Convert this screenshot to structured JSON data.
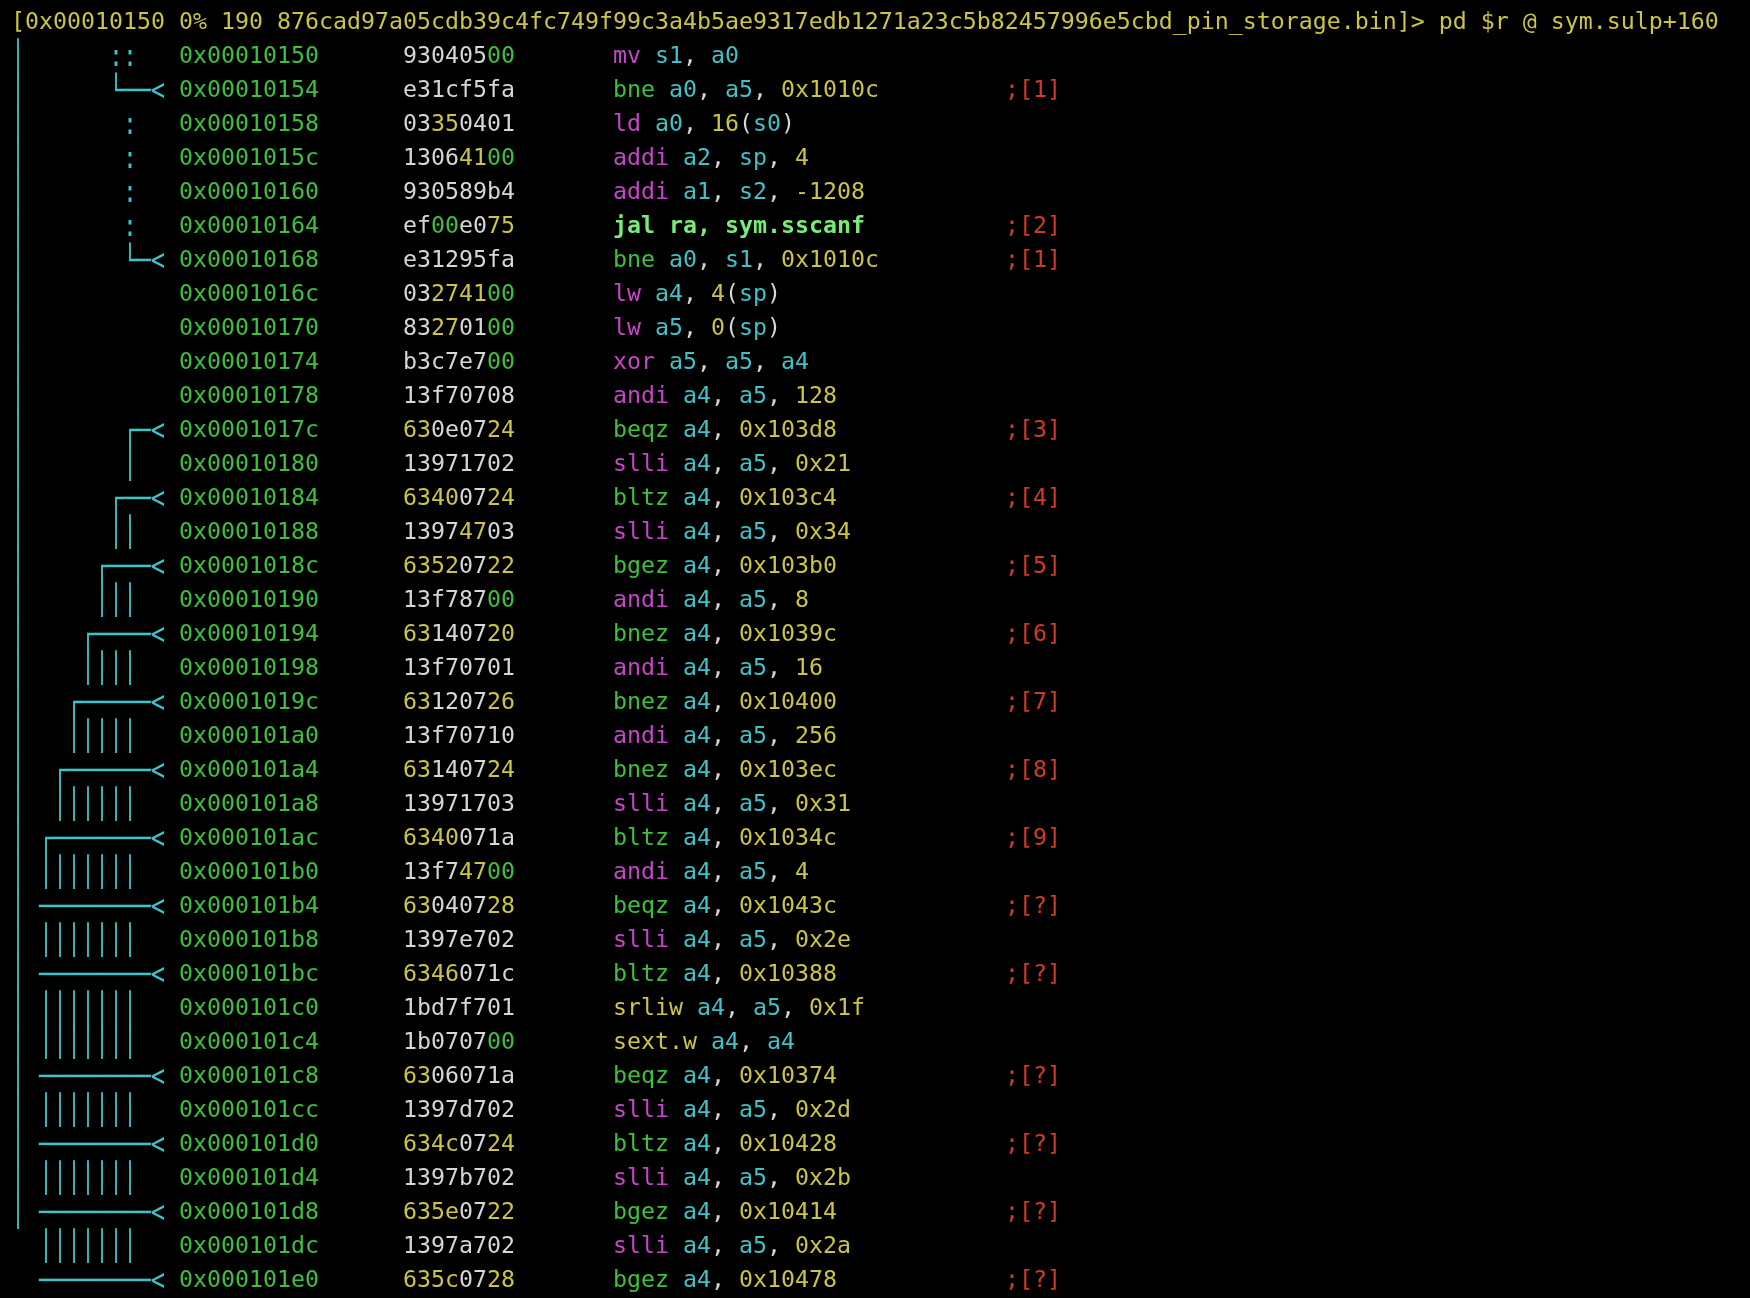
{
  "prompt": {
    "text": "[0x00010150 0% 190 876cad97a05cdb39c4fc749f99c3a4b5ae9317edb1271a23c5b82457996e5cbd_pin_storage.bin]> pd $r @ sym.sulp+160"
  },
  "lines": [
    {
      "graph": "│      ::",
      "address": "0x00010150",
      "bytes": [
        {
          "hex": "930405",
          "kind": "other"
        },
        {
          "hex": "00",
          "kind": "zero"
        }
      ],
      "instruction": {
        "mnemonic": "mv",
        "kind": "move",
        "operands": [
          {
            "text": "s1",
            "kind": "register"
          },
          {
            "text": ", ",
            "kind": "punct"
          },
          {
            "text": "a0",
            "kind": "register"
          }
        ]
      }
    },
    {
      "graph": "│      └──<",
      "address": "0x00010154",
      "bytes": [
        {
          "hex": "e31cf5fa",
          "kind": "other"
        }
      ],
      "instruction": {
        "mnemonic": "bne",
        "kind": "branch",
        "operands": [
          {
            "text": "a0",
            "kind": "register"
          },
          {
            "text": ", ",
            "kind": "punct"
          },
          {
            "text": "a5",
            "kind": "register"
          },
          {
            "text": ", ",
            "kind": "punct"
          },
          {
            "text": "0x1010c",
            "kind": "number"
          }
        ]
      },
      "comment": ";[1]"
    },
    {
      "graph": "│       :",
      "address": "0x00010158",
      "bytes": [
        {
          "hex": "03",
          "kind": "other"
        },
        {
          "hex": "35",
          "kind": "printable"
        },
        {
          "hex": "0401",
          "kind": "other"
        }
      ],
      "instruction": {
        "mnemonic": "ld",
        "kind": "load",
        "operands": [
          {
            "text": "a0",
            "kind": "register"
          },
          {
            "text": ", ",
            "kind": "punct"
          },
          {
            "text": "16",
            "kind": "number"
          },
          {
            "text": "(",
            "kind": "punct"
          },
          {
            "text": "s0",
            "kind": "register"
          },
          {
            "text": ")",
            "kind": "punct"
          }
        ]
      }
    },
    {
      "graph": "│       :",
      "address": "0x0001015c",
      "bytes": [
        {
          "hex": "1306",
          "kind": "other"
        },
        {
          "hex": "41",
          "kind": "printable"
        },
        {
          "hex": "00",
          "kind": "zero"
        }
      ],
      "instruction": {
        "mnemonic": "addi",
        "kind": "math",
        "operands": [
          {
            "text": "a2",
            "kind": "register"
          },
          {
            "text": ", ",
            "kind": "punct"
          },
          {
            "text": "sp",
            "kind": "register"
          },
          {
            "text": ", ",
            "kind": "punct"
          },
          {
            "text": "4",
            "kind": "number"
          }
        ]
      }
    },
    {
      "graph": "│       :",
      "address": "0x00010160",
      "bytes": [
        {
          "hex": "930589b4",
          "kind": "other"
        }
      ],
      "instruction": {
        "mnemonic": "addi",
        "kind": "math",
        "operands": [
          {
            "text": "a1",
            "kind": "register"
          },
          {
            "text": ", ",
            "kind": "punct"
          },
          {
            "text": "s2",
            "kind": "register"
          },
          {
            "text": ", ",
            "kind": "punct"
          },
          {
            "text": "-1208",
            "kind": "number"
          }
        ]
      }
    },
    {
      "graph": "│       :",
      "address": "0x00010164",
      "bytes": [
        {
          "hex": "ef",
          "kind": "other"
        },
        {
          "hex": "00",
          "kind": "zero"
        },
        {
          "hex": "e0",
          "kind": "other"
        },
        {
          "hex": "75",
          "kind": "printable"
        }
      ],
      "instruction": {
        "mnemonic": "jal",
        "kind": "call",
        "operands": [
          {
            "text": "ra",
            "kind": "register"
          },
          {
            "text": ", ",
            "kind": "punct"
          },
          {
            "text": "sym.sscanf",
            "kind": "symbol"
          }
        ]
      },
      "comment": ";[2]"
    },
    {
      "graph": "│       └─<",
      "address": "0x00010168",
      "bytes": [
        {
          "hex": "e31295fa",
          "kind": "other"
        }
      ],
      "instruction": {
        "mnemonic": "bne",
        "kind": "branch",
        "operands": [
          {
            "text": "a0",
            "kind": "register"
          },
          {
            "text": ", ",
            "kind": "punct"
          },
          {
            "text": "s1",
            "kind": "register"
          },
          {
            "text": ", ",
            "kind": "punct"
          },
          {
            "text": "0x1010c",
            "kind": "number"
          }
        ]
      },
      "comment": ";[1]"
    },
    {
      "graph": "│",
      "address": "0x0001016c",
      "bytes": [
        {
          "hex": "03",
          "kind": "other"
        },
        {
          "hex": "2741",
          "kind": "printable"
        },
        {
          "hex": "00",
          "kind": "zero"
        }
      ],
      "instruction": {
        "mnemonic": "lw",
        "kind": "load",
        "operands": [
          {
            "text": "a4",
            "kind": "register"
          },
          {
            "text": ", ",
            "kind": "punct"
          },
          {
            "text": "4",
            "kind": "number"
          },
          {
            "text": "(",
            "kind": "punct"
          },
          {
            "text": "sp",
            "kind": "register"
          },
          {
            "text": ")",
            "kind": "punct"
          }
        ]
      }
    },
    {
      "graph": "│",
      "address": "0x00010170",
      "bytes": [
        {
          "hex": "83",
          "kind": "other"
        },
        {
          "hex": "27",
          "kind": "printable"
        },
        {
          "hex": "01",
          "kind": "other"
        },
        {
          "hex": "00",
          "kind": "zero"
        }
      ],
      "instruction": {
        "mnemonic": "lw",
        "kind": "load",
        "operands": [
          {
            "text": "a5",
            "kind": "register"
          },
          {
            "text": ", ",
            "kind": "punct"
          },
          {
            "text": "0",
            "kind": "number"
          },
          {
            "text": "(",
            "kind": "punct"
          },
          {
            "text": "sp",
            "kind": "register"
          },
          {
            "text": ")",
            "kind": "punct"
          }
        ]
      }
    },
    {
      "graph": "│",
      "address": "0x00010174",
      "bytes": [
        {
          "hex": "b3c7e7",
          "kind": "other"
        },
        {
          "hex": "00",
          "kind": "zero"
        }
      ],
      "instruction": {
        "mnemonic": "xor",
        "kind": "math",
        "operands": [
          {
            "text": "a5",
            "kind": "register"
          },
          {
            "text": ", ",
            "kind": "punct"
          },
          {
            "text": "a5",
            "kind": "register"
          },
          {
            "text": ", ",
            "kind": "punct"
          },
          {
            "text": "a4",
            "kind": "register"
          }
        ]
      }
    },
    {
      "graph": "│",
      "address": "0x00010178",
      "bytes": [
        {
          "hex": "13f70708",
          "kind": "other"
        }
      ],
      "instruction": {
        "mnemonic": "andi",
        "kind": "math",
        "operands": [
          {
            "text": "a4",
            "kind": "register"
          },
          {
            "text": ", ",
            "kind": "punct"
          },
          {
            "text": "a5",
            "kind": "register"
          },
          {
            "text": ", ",
            "kind": "punct"
          },
          {
            "text": "128",
            "kind": "number"
          }
        ]
      }
    },
    {
      "graph": "│       ┌─<",
      "address": "0x0001017c",
      "bytes": [
        {
          "hex": "63",
          "kind": "printable"
        },
        {
          "hex": "0e07",
          "kind": "other"
        },
        {
          "hex": "24",
          "kind": "printable"
        }
      ],
      "instruction": {
        "mnemonic": "beqz",
        "kind": "branch",
        "operands": [
          {
            "text": "a4",
            "kind": "register"
          },
          {
            "text": ", ",
            "kind": "punct"
          },
          {
            "text": "0x103d8",
            "kind": "number"
          }
        ]
      },
      "comment": ";[3]"
    },
    {
      "graph": "│       │",
      "address": "0x00010180",
      "bytes": [
        {
          "hex": "13971702",
          "kind": "other"
        }
      ],
      "instruction": {
        "mnemonic": "slli",
        "kind": "math",
        "operands": [
          {
            "text": "a4",
            "kind": "register"
          },
          {
            "text": ", ",
            "kind": "punct"
          },
          {
            "text": "a5",
            "kind": "register"
          },
          {
            "text": ", ",
            "kind": "punct"
          },
          {
            "text": "0x21",
            "kind": "number"
          }
        ]
      }
    },
    {
      "graph": "│      ┌──<",
      "address": "0x00010184",
      "bytes": [
        {
          "hex": "6340",
          "kind": "printable"
        },
        {
          "hex": "07",
          "kind": "other"
        },
        {
          "hex": "24",
          "kind": "printable"
        }
      ],
      "instruction": {
        "mnemonic": "bltz",
        "kind": "branch",
        "operands": [
          {
            "text": "a4",
            "kind": "register"
          },
          {
            "text": ", ",
            "kind": "punct"
          },
          {
            "text": "0x103c4",
            "kind": "number"
          }
        ]
      },
      "comment": ";[4]"
    },
    {
      "graph": "│      ││",
      "address": "0x00010188",
      "bytes": [
        {
          "hex": "1397",
          "kind": "other"
        },
        {
          "hex": "47",
          "kind": "printable"
        },
        {
          "hex": "03",
          "kind": "other"
        }
      ],
      "instruction": {
        "mnemonic": "slli",
        "kind": "math",
        "operands": [
          {
            "text": "a4",
            "kind": "register"
          },
          {
            "text": ", ",
            "kind": "punct"
          },
          {
            "text": "a5",
            "kind": "register"
          },
          {
            "text": ", ",
            "kind": "punct"
          },
          {
            "text": "0x34",
            "kind": "number"
          }
        ]
      }
    },
    {
      "graph": "│     ┌───<",
      "address": "0x0001018c",
      "bytes": [
        {
          "hex": "6352",
          "kind": "printable"
        },
        {
          "hex": "07",
          "kind": "other"
        },
        {
          "hex": "22",
          "kind": "printable"
        }
      ],
      "instruction": {
        "mnemonic": "bgez",
        "kind": "branch",
        "operands": [
          {
            "text": "a4",
            "kind": "register"
          },
          {
            "text": ", ",
            "kind": "punct"
          },
          {
            "text": "0x103b0",
            "kind": "number"
          }
        ]
      },
      "comment": ";[5]"
    },
    {
      "graph": "│     │││",
      "address": "0x00010190",
      "bytes": [
        {
          "hex": "13f787",
          "kind": "other"
        },
        {
          "hex": "00",
          "kind": "zero"
        }
      ],
      "instruction": {
        "mnemonic": "andi",
        "kind": "math",
        "operands": [
          {
            "text": "a4",
            "kind": "register"
          },
          {
            "text": ", ",
            "kind": "punct"
          },
          {
            "text": "a5",
            "kind": "register"
          },
          {
            "text": ", ",
            "kind": "punct"
          },
          {
            "text": "8",
            "kind": "number"
          }
        ]
      }
    },
    {
      "graph": "│    ┌────<",
      "address": "0x00010194",
      "bytes": [
        {
          "hex": "63",
          "kind": "printable"
        },
        {
          "hex": "1407",
          "kind": "other"
        },
        {
          "hex": "20",
          "kind": "printable"
        }
      ],
      "instruction": {
        "mnemonic": "bnez",
        "kind": "branch",
        "operands": [
          {
            "text": "a4",
            "kind": "register"
          },
          {
            "text": ", ",
            "kind": "punct"
          },
          {
            "text": "0x1039c",
            "kind": "number"
          }
        ]
      },
      "comment": ";[6]"
    },
    {
      "graph": "│    ││││",
      "address": "0x00010198",
      "bytes": [
        {
          "hex": "13f70701",
          "kind": "other"
        }
      ],
      "instruction": {
        "mnemonic": "andi",
        "kind": "math",
        "operands": [
          {
            "text": "a4",
            "kind": "register"
          },
          {
            "text": ", ",
            "kind": "punct"
          },
          {
            "text": "a5",
            "kind": "register"
          },
          {
            "text": ", ",
            "kind": "punct"
          },
          {
            "text": "16",
            "kind": "number"
          }
        ]
      }
    },
    {
      "graph": "│   ┌─────<",
      "address": "0x0001019c",
      "bytes": [
        {
          "hex": "63",
          "kind": "printable"
        },
        {
          "hex": "1207",
          "kind": "other"
        },
        {
          "hex": "26",
          "kind": "printable"
        }
      ],
      "instruction": {
        "mnemonic": "bnez",
        "kind": "branch",
        "operands": [
          {
            "text": "a4",
            "kind": "register"
          },
          {
            "text": ", ",
            "kind": "punct"
          },
          {
            "text": "0x10400",
            "kind": "number"
          }
        ]
      },
      "comment": ";[7]"
    },
    {
      "graph": "│   │││││",
      "address": "0x000101a0",
      "bytes": [
        {
          "hex": "13f70710",
          "kind": "other"
        }
      ],
      "instruction": {
        "mnemonic": "andi",
        "kind": "math",
        "operands": [
          {
            "text": "a4",
            "kind": "register"
          },
          {
            "text": ", ",
            "kind": "punct"
          },
          {
            "text": "a5",
            "kind": "register"
          },
          {
            "text": ", ",
            "kind": "punct"
          },
          {
            "text": "256",
            "kind": "number"
          }
        ]
      }
    },
    {
      "graph": "│  ┌──────<",
      "address": "0x000101a4",
      "bytes": [
        {
          "hex": "63",
          "kind": "printable"
        },
        {
          "hex": "1407",
          "kind": "other"
        },
        {
          "hex": "24",
          "kind": "printable"
        }
      ],
      "instruction": {
        "mnemonic": "bnez",
        "kind": "branch",
        "operands": [
          {
            "text": "a4",
            "kind": "register"
          },
          {
            "text": ", ",
            "kind": "punct"
          },
          {
            "text": "0x103ec",
            "kind": "number"
          }
        ]
      },
      "comment": ";[8]"
    },
    {
      "graph": "│  ││││││",
      "address": "0x000101a8",
      "bytes": [
        {
          "hex": "13971703",
          "kind": "other"
        }
      ],
      "instruction": {
        "mnemonic": "slli",
        "kind": "math",
        "operands": [
          {
            "text": "a4",
            "kind": "register"
          },
          {
            "text": ", ",
            "kind": "punct"
          },
          {
            "text": "a5",
            "kind": "register"
          },
          {
            "text": ", ",
            "kind": "punct"
          },
          {
            "text": "0x31",
            "kind": "number"
          }
        ]
      }
    },
    {
      "graph": "│ ┌───────<",
      "address": "0x000101ac",
      "bytes": [
        {
          "hex": "6340",
          "kind": "printable"
        },
        {
          "hex": "071a",
          "kind": "other"
        }
      ],
      "instruction": {
        "mnemonic": "bltz",
        "kind": "branch",
        "operands": [
          {
            "text": "a4",
            "kind": "register"
          },
          {
            "text": ", ",
            "kind": "punct"
          },
          {
            "text": "0x1034c",
            "kind": "number"
          }
        ]
      },
      "comment": ";[9]"
    },
    {
      "graph": "│ │││││││",
      "address": "0x000101b0",
      "bytes": [
        {
          "hex": "13f7",
          "kind": "other"
        },
        {
          "hex": "47",
          "kind": "printable"
        },
        {
          "hex": "00",
          "kind": "zero"
        }
      ],
      "instruction": {
        "mnemonic": "andi",
        "kind": "math",
        "operands": [
          {
            "text": "a4",
            "kind": "register"
          },
          {
            "text": ", ",
            "kind": "punct"
          },
          {
            "text": "a5",
            "kind": "register"
          },
          {
            "text": ", ",
            "kind": "punct"
          },
          {
            "text": "4",
            "kind": "number"
          }
        ]
      }
    },
    {
      "graph": "│ ────────<",
      "address": "0x000101b4",
      "bytes": [
        {
          "hex": "63",
          "kind": "printable"
        },
        {
          "hex": "0407",
          "kind": "other"
        },
        {
          "hex": "28",
          "kind": "printable"
        }
      ],
      "instruction": {
        "mnemonic": "beqz",
        "kind": "branch",
        "operands": [
          {
            "text": "a4",
            "kind": "register"
          },
          {
            "text": ", ",
            "kind": "punct"
          },
          {
            "text": "0x1043c",
            "kind": "number"
          }
        ]
      },
      "comment": ";[?]"
    },
    {
      "graph": "│ │││││││",
      "address": "0x000101b8",
      "bytes": [
        {
          "hex": "1397e702",
          "kind": "other"
        }
      ],
      "instruction": {
        "mnemonic": "slli",
        "kind": "math",
        "operands": [
          {
            "text": "a4",
            "kind": "register"
          },
          {
            "text": ", ",
            "kind": "punct"
          },
          {
            "text": "a5",
            "kind": "register"
          },
          {
            "text": ", ",
            "kind": "punct"
          },
          {
            "text": "0x2e",
            "kind": "number"
          }
        ]
      }
    },
    {
      "graph": "│ ────────<",
      "address": "0x000101bc",
      "bytes": [
        {
          "hex": "6346",
          "kind": "printable"
        },
        {
          "hex": "071c",
          "kind": "other"
        }
      ],
      "instruction": {
        "mnemonic": "bltz",
        "kind": "branch",
        "operands": [
          {
            "text": "a4",
            "kind": "register"
          },
          {
            "text": ", ",
            "kind": "punct"
          },
          {
            "text": "0x10388",
            "kind": "number"
          }
        ]
      },
      "comment": ";[?]"
    },
    {
      "graph": "│ │││││││",
      "address": "0x000101c0",
      "bytes": [
        {
          "hex": "1bd7f701",
          "kind": "other"
        }
      ],
      "instruction": {
        "mnemonic": "srliw",
        "kind": "other",
        "operands": [
          {
            "text": "a4",
            "kind": "register"
          },
          {
            "text": ", ",
            "kind": "punct"
          },
          {
            "text": "a5",
            "kind": "register"
          },
          {
            "text": ", ",
            "kind": "punct"
          },
          {
            "text": "0x1f",
            "kind": "number"
          }
        ]
      }
    },
    {
      "graph": "│ │││││││",
      "address": "0x000101c4",
      "bytes": [
        {
          "hex": "1b0707",
          "kind": "other"
        },
        {
          "hex": "00",
          "kind": "zero"
        }
      ],
      "instruction": {
        "mnemonic": "sext.w",
        "kind": "other",
        "operands": [
          {
            "text": "a4",
            "kind": "register"
          },
          {
            "text": ", ",
            "kind": "punct"
          },
          {
            "text": "a4",
            "kind": "register"
          }
        ]
      }
    },
    {
      "graph": "│ ────────<",
      "address": "0x000101c8",
      "bytes": [
        {
          "hex": "63",
          "kind": "printable"
        },
        {
          "hex": "06071a",
          "kind": "other"
        }
      ],
      "instruction": {
        "mnemonic": "beqz",
        "kind": "branch",
        "operands": [
          {
            "text": "a4",
            "kind": "register"
          },
          {
            "text": ", ",
            "kind": "punct"
          },
          {
            "text": "0x10374",
            "kind": "number"
          }
        ]
      },
      "comment": ";[?]"
    },
    {
      "graph": "│ │││││││",
      "address": "0x000101cc",
      "bytes": [
        {
          "hex": "1397d702",
          "kind": "other"
        }
      ],
      "instruction": {
        "mnemonic": "slli",
        "kind": "math",
        "operands": [
          {
            "text": "a4",
            "kind": "register"
          },
          {
            "text": ", ",
            "kind": "punct"
          },
          {
            "text": "a5",
            "kind": "register"
          },
          {
            "text": ", ",
            "kind": "punct"
          },
          {
            "text": "0x2d",
            "kind": "number"
          }
        ]
      }
    },
    {
      "graph": "│ ────────<",
      "address": "0x000101d0",
      "bytes": [
        {
          "hex": "634c",
          "kind": "printable"
        },
        {
          "hex": "07",
          "kind": "other"
        },
        {
          "hex": "24",
          "kind": "printable"
        }
      ],
      "instruction": {
        "mnemonic": "bltz",
        "kind": "branch",
        "operands": [
          {
            "text": "a4",
            "kind": "register"
          },
          {
            "text": ", ",
            "kind": "punct"
          },
          {
            "text": "0x10428",
            "kind": "number"
          }
        ]
      },
      "comment": ";[?]"
    },
    {
      "graph": "│ │││││││",
      "address": "0x000101d4",
      "bytes": [
        {
          "hex": "1397b702",
          "kind": "other"
        }
      ],
      "instruction": {
        "mnemonic": "slli",
        "kind": "math",
        "operands": [
          {
            "text": "a4",
            "kind": "register"
          },
          {
            "text": ", ",
            "kind": "punct"
          },
          {
            "text": "a5",
            "kind": "register"
          },
          {
            "text": ", ",
            "kind": "punct"
          },
          {
            "text": "0x2b",
            "kind": "number"
          }
        ]
      }
    },
    {
      "graph": "│ ────────<",
      "address": "0x000101d8",
      "bytes": [
        {
          "hex": "635e",
          "kind": "printable"
        },
        {
          "hex": "07",
          "kind": "other"
        },
        {
          "hex": "22",
          "kind": "printable"
        }
      ],
      "instruction": {
        "mnemonic": "bgez",
        "kind": "branch",
        "operands": [
          {
            "text": "a4",
            "kind": "register"
          },
          {
            "text": ", ",
            "kind": "punct"
          },
          {
            "text": "0x10414",
            "kind": "number"
          }
        ]
      },
      "comment": ";[?]"
    },
    {
      "graph": "  │││││││",
      "address": "0x000101dc",
      "bytes": [
        {
          "hex": "1397a702",
          "kind": "other"
        }
      ],
      "instruction": {
        "mnemonic": "slli",
        "kind": "math",
        "operands": [
          {
            "text": "a4",
            "kind": "register"
          },
          {
            "text": ", ",
            "kind": "punct"
          },
          {
            "text": "a5",
            "kind": "register"
          },
          {
            "text": ", ",
            "kind": "punct"
          },
          {
            "text": "0x2a",
            "kind": "number"
          }
        ]
      }
    },
    {
      "graph": "  ────────<",
      "address": "0x000101e0",
      "bytes": [
        {
          "hex": "635c",
          "kind": "printable"
        },
        {
          "hex": "07",
          "kind": "other"
        },
        {
          "hex": "28",
          "kind": "printable"
        }
      ],
      "instruction": {
        "mnemonic": "bgez",
        "kind": "branch",
        "operands": [
          {
            "text": "a4",
            "kind": "register"
          },
          {
            "text": ", ",
            "kind": "punct"
          },
          {
            "text": "0x10478",
            "kind": "number"
          }
        ]
      },
      "comment": ";[?]"
    }
  ]
}
